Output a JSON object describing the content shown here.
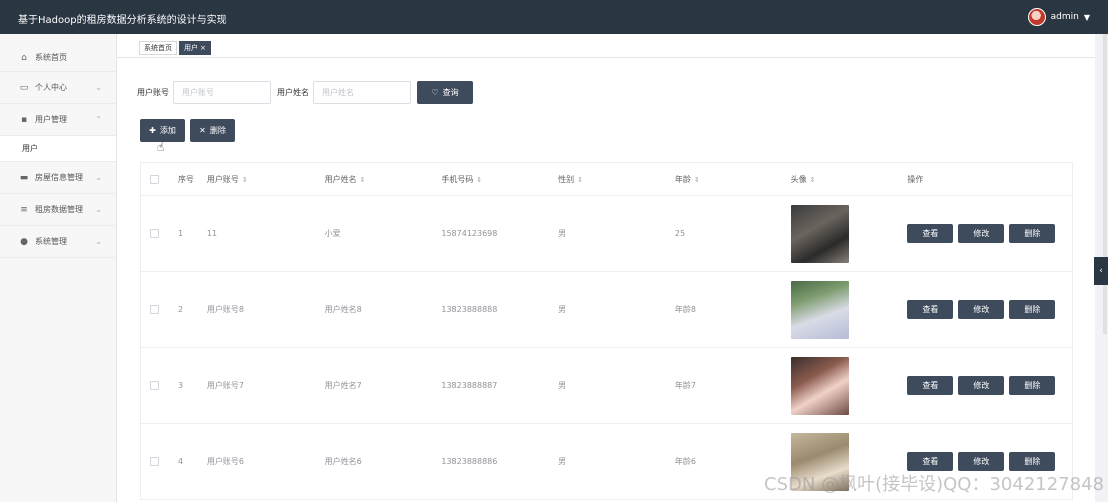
{
  "app": {
    "title": "基于Hadoop的租房数据分析系统的设计与实现",
    "username": "admin"
  },
  "sidebar": {
    "items": [
      {
        "label": "系统首页",
        "icon": "home-icon",
        "glyph": "⌂"
      },
      {
        "label": "个人中心",
        "icon": "profile-icon",
        "glyph": "▭"
      },
      {
        "label": "用户管理",
        "icon": "grid-icon",
        "glyph": "▪"
      },
      {
        "label": "用户",
        "icon": "",
        "glyph": ""
      },
      {
        "label": "房屋信息管理",
        "icon": "monitor-icon",
        "glyph": "▬"
      },
      {
        "label": "租房数据管理",
        "icon": "sliders-icon",
        "glyph": "≡"
      },
      {
        "label": "系统管理",
        "icon": "location-icon",
        "glyph": "●"
      }
    ]
  },
  "tabs": [
    {
      "label": "系统首页"
    },
    {
      "label": "用户",
      "close": "×"
    }
  ],
  "search": {
    "account_label": "用户账号",
    "account_placeholder": "用户账号",
    "name_label": "用户姓名",
    "name_placeholder": "用户姓名",
    "button_label": "查询"
  },
  "actions": {
    "add_label": "添加",
    "delete_label": "删除"
  },
  "table": {
    "columns": [
      "序号",
      "用户账号",
      "用户姓名",
      "手机号码",
      "性别",
      "年龄",
      "头像",
      "操作"
    ],
    "rows": [
      {
        "no": "1",
        "account": "11",
        "name": "小爱",
        "phone": "15874123698",
        "sex": "男",
        "age": "25"
      },
      {
        "no": "2",
        "account": "用户账号8",
        "name": "用户姓名8",
        "phone": "13823888888",
        "sex": "男",
        "age": "年龄8"
      },
      {
        "no": "3",
        "account": "用户账号7",
        "name": "用户姓名7",
        "phone": "13823888887",
        "sex": "男",
        "age": "年龄7"
      },
      {
        "no": "4",
        "account": "用户账号6",
        "name": "用户姓名6",
        "phone": "13823888886",
        "sex": "男",
        "age": "年龄6"
      }
    ],
    "op_view": "查看",
    "op_edit": "修改",
    "op_delete": "删除"
  },
  "watermark": "CSDN @枫叶(接毕设)QQ：3042127848",
  "colors": {
    "topbar": "#2b3643",
    "button": "#3d4b5c",
    "accent": "#3d4b5c"
  }
}
